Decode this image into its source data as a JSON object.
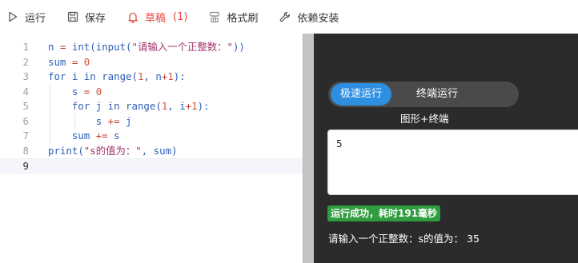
{
  "toolbar": {
    "run": {
      "label": "运行",
      "icon": "play-icon"
    },
    "save": {
      "label": "保存",
      "icon": "floppy-icon"
    },
    "draft": {
      "label": "草稿",
      "count": "(1)",
      "icon": "bell-icon",
      "color": "#e8483f"
    },
    "format": {
      "label": "格式刷",
      "icon": "format-brush-icon"
    },
    "deps": {
      "label": "依赖安装",
      "icon": "wrench-icon"
    }
  },
  "editor": {
    "active_line": 9,
    "lines": [
      {
        "n": "1",
        "text": "n = int(input(\"请输入一个正整数：\"))"
      },
      {
        "n": "2",
        "text": "sum = 0"
      },
      {
        "n": "3",
        "text": "for i in range(1, n+1):"
      },
      {
        "n": "4",
        "text": "    s = 0"
      },
      {
        "n": "5",
        "text": "    for j in range(1, i+1):"
      },
      {
        "n": "6",
        "text": "        s += j"
      },
      {
        "n": "7",
        "text": "    sum += s"
      },
      {
        "n": "8",
        "text": "print(\"s的值为：\", sum)"
      },
      {
        "n": "9",
        "text": ""
      }
    ]
  },
  "panel": {
    "modes": [
      "极速运行",
      "终端运行"
    ],
    "active_mode": "极速运行",
    "sub_mode": "图形+终端",
    "stdin_value": "5",
    "status": "运行成功，耗时191毫秒",
    "output": "请输入一个正整数：s的值为： 35"
  },
  "colors": {
    "accent": "#2e8fe0",
    "success": "#2f9c3d",
    "panel_bg": "#2b2b2b"
  }
}
